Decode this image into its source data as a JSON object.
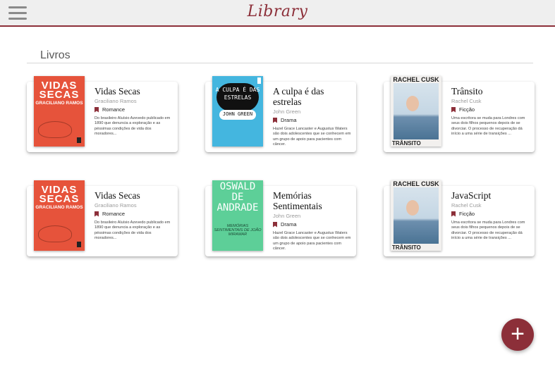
{
  "app": {
    "title": "Library"
  },
  "section": {
    "title": "Livros"
  },
  "books": [
    {
      "title": "Vidas Secas",
      "author": "Graciliano Ramos",
      "genre": "Romance",
      "description": "Do brasileiro Aluísio Azevedo publicado em 1890 que denuncia a exploração e as péssimas condições de vida dos moradores...",
      "cover": {
        "line1": "VIDAS SECAS",
        "line2": "GRACILIANO RAMOS"
      }
    },
    {
      "title": "A culpa é das estrelas",
      "author": "John Green",
      "genre": "Drama",
      "description": "Hazel Grace Lancaster e Augustus Waters são dois adolescentes que se conhecem em um grupo de apoio para pacientes com câncer.",
      "cover": {
        "line1": "A CULPA É DAS ESTRELAS",
        "line2": "JOHN GREEN"
      }
    },
    {
      "title": "Trânsito",
      "author": "Rachel Cusk",
      "genre": "Ficção",
      "description": "Uma escritora se muda para Londres com seus dois filhos pequenos depois de se divorciar. O processo de recuperação dá início a uma série de transições ...",
      "cover": {
        "line1": "RACHEL CUSK",
        "line2": "TRÂNSITO"
      }
    },
    {
      "title": "Vidas Secas",
      "author": "Graciliano Ramos",
      "genre": "Romance",
      "description": "Do brasileiro Aluísio Azevedo publicado em 1890 que denuncia a exploração e as péssimas condições de vida dos moradores...",
      "cover": {
        "line1": "VIDAS SECAS",
        "line2": "GRACILIANO RAMOS"
      }
    },
    {
      "title": "Memórias Sentimentais",
      "author": "John Green",
      "genre": "Drama",
      "description": "Hazel Grace Lancaster e Augustus Waters são dois adolescentes que se conhecem em um grupo de apoio para pacientes com câncer.",
      "cover": {
        "line1": "OSWALD DE ANDRADE",
        "line2": "MEMÓRIAS SENTIMENTAIS DE JOÃO MIRAMAR"
      }
    },
    {
      "title": "JavaScript",
      "author": "Rachel Cusk",
      "genre": "Ficção",
      "description": "Uma escritora se muda para Londres com seus dois filhos pequenos depois de se divorciar. O processo de recuperação dá início a uma série de transições ...",
      "cover": {
        "line1": "RACHEL CUSK",
        "line2": "TRÂNSITO"
      }
    }
  ],
  "fab": {
    "label": "+"
  },
  "colors": {
    "accent": "#8c2f39",
    "topbar": "#efefef"
  }
}
